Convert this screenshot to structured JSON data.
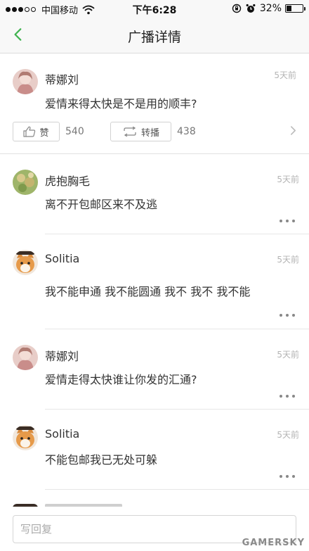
{
  "status_bar": {
    "carrier": "中国移动",
    "time": "下午6:28",
    "battery_percent": "32%",
    "battery_level": 0.32,
    "signal_bars_filled": 3,
    "signal_bars_total": 5,
    "icons": [
      "signal-icon",
      "wifi-icon",
      "rotation-lock-icon",
      "alarm-icon",
      "battery-icon"
    ]
  },
  "nav": {
    "title": "广播详情",
    "back_icon": "chevron-left-icon"
  },
  "post": {
    "username": "蒂娜刘",
    "time": "5天前",
    "content": "爱情来得太快是不是用的顺丰?",
    "like_label": "赞",
    "like_count": "540",
    "repost_label": "转播",
    "repost_count": "438"
  },
  "comments": [
    {
      "username": "虎抱胸毛",
      "time": "5天前",
      "content": "离不开包邮区来不及逃"
    },
    {
      "username": "Solitia",
      "time": "5天前",
      "content": "我不能申通 我不能圆通 我不 我不 我不能"
    },
    {
      "username": "蒂娜刘",
      "time": "5天前",
      "content": "爱情走得太快谁让你发的汇通?"
    },
    {
      "username": "Solitia",
      "time": "5天前",
      "content": "不能包邮我已无处可躲"
    }
  ],
  "reply": {
    "placeholder": "写回复"
  },
  "watermark": "GAMERSKY",
  "colors": {
    "accent_green": "#3fb34f",
    "bar_background": "#f8f8f8",
    "time_gray": "#b4b4b4"
  }
}
